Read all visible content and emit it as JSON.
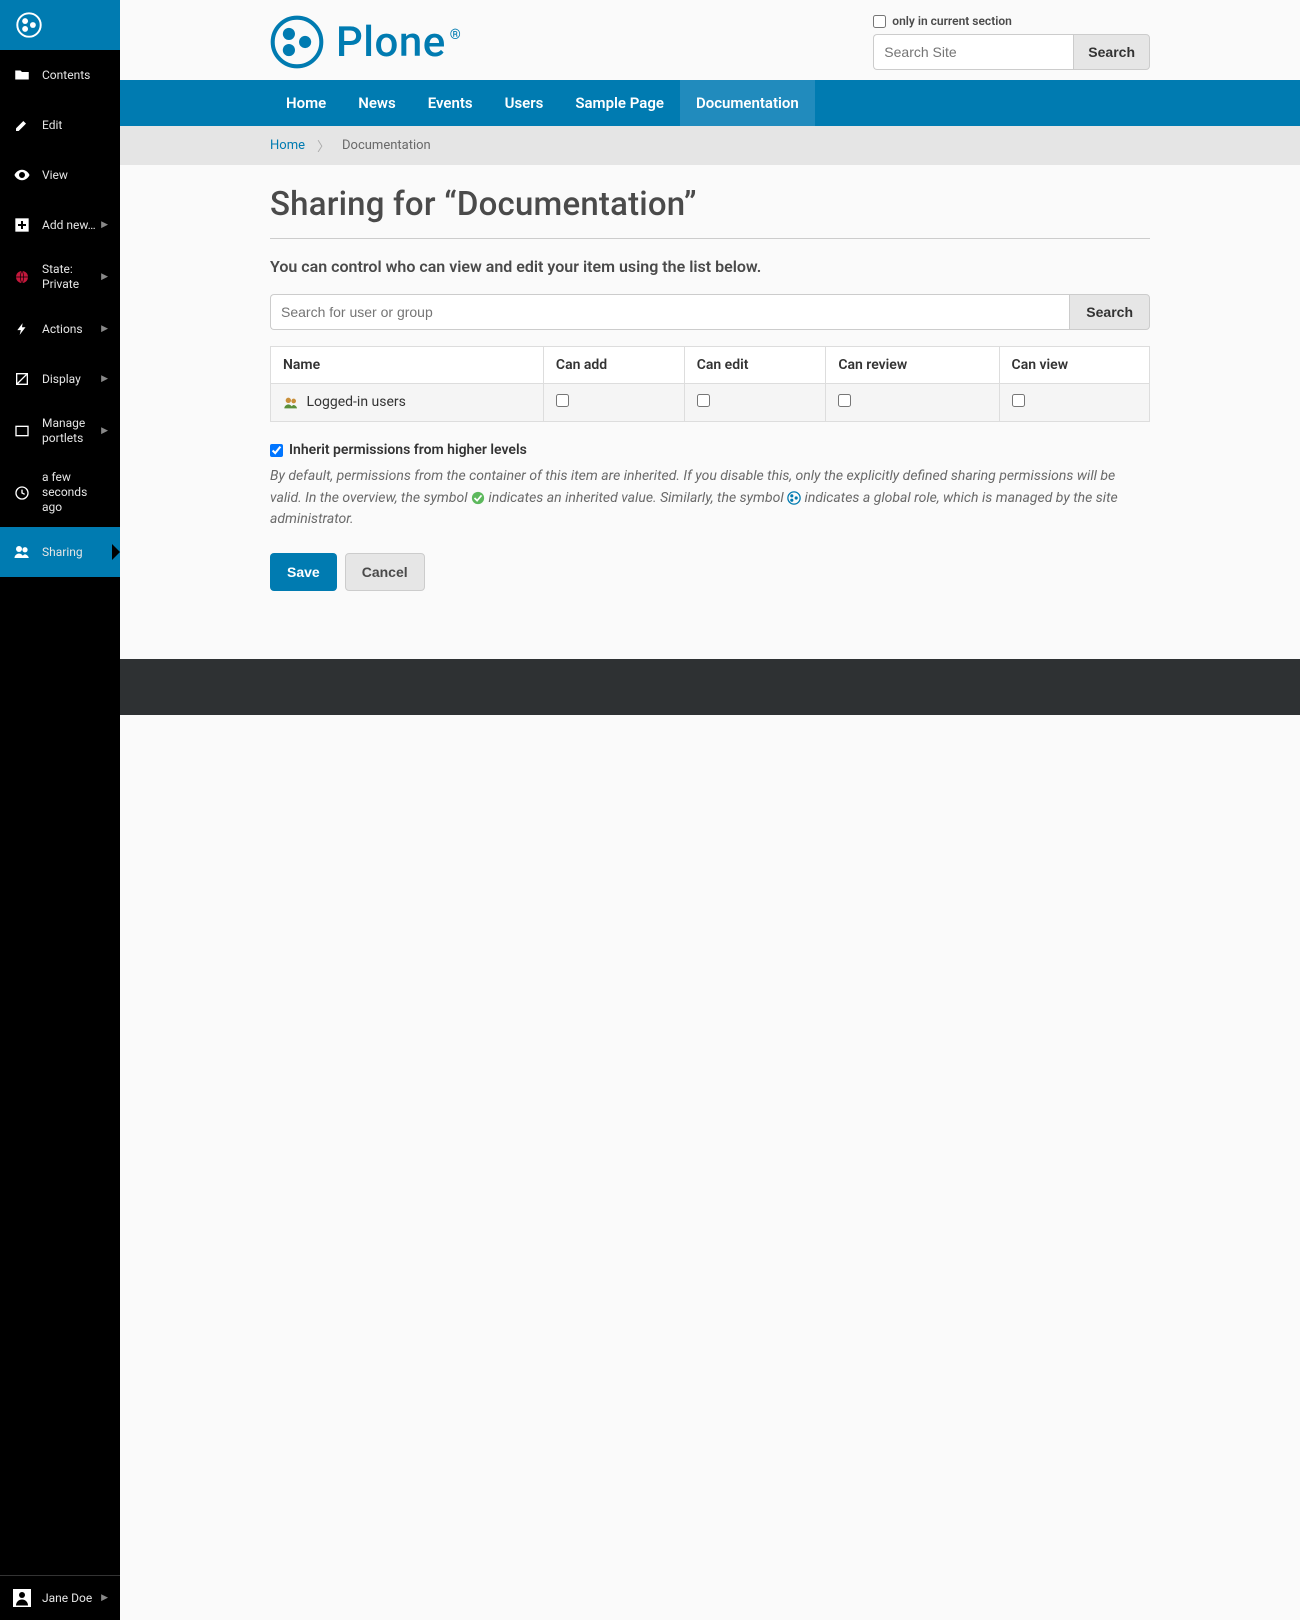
{
  "sidebar": {
    "items": [
      {
        "label": "Contents",
        "icon": "folder-icon",
        "caret": false
      },
      {
        "label": "Edit",
        "icon": "pencil-icon",
        "caret": false
      },
      {
        "label": "View",
        "icon": "eye-icon",
        "caret": false
      },
      {
        "label": "Add new…",
        "icon": "plus-icon",
        "caret": true
      },
      {
        "label": "State: Private",
        "icon": "globe-red-icon",
        "caret": true
      },
      {
        "label": "Actions",
        "icon": "bolt-icon",
        "caret": true
      },
      {
        "label": "Display",
        "icon": "shapes-icon",
        "caret": true
      },
      {
        "label": "Manage portlets",
        "icon": "square-icon",
        "caret": true
      },
      {
        "label": "a few seconds ago",
        "icon": "clock-icon",
        "caret": false
      },
      {
        "label": "Sharing",
        "icon": "people-icon",
        "caret": false,
        "active": true
      }
    ],
    "user": {
      "label": "Jane Doe",
      "icon": "user-icon"
    }
  },
  "brand": {
    "name": "Plone"
  },
  "search": {
    "only_label": "only in current section",
    "placeholder": "Search Site",
    "button": "Search"
  },
  "nav": {
    "tabs": [
      {
        "label": "Home"
      },
      {
        "label": "News"
      },
      {
        "label": "Events"
      },
      {
        "label": "Users"
      },
      {
        "label": "Sample Page"
      },
      {
        "label": "Documentation",
        "active": true
      }
    ]
  },
  "breadcrumb": {
    "home": "Home",
    "current": "Documentation"
  },
  "page": {
    "title": "Sharing for “Documentation”",
    "subtitle": "You can control who can view and edit your item using the list below.",
    "user_search_placeholder": "Search for user or group",
    "user_search_button": "Search",
    "table": {
      "headers": [
        "Name",
        "Can add",
        "Can edit",
        "Can review",
        "Can view"
      ],
      "rows": [
        {
          "name": "Logged-in users",
          "can_add": false,
          "can_edit": false,
          "can_review": false,
          "can_view": false
        }
      ]
    },
    "inherit_label": "Inherit permissions from higher levels",
    "inherit_desc_1": "By default, permissions from the container of this item are inherited. If you disable this, only the explicitly defined sharing permissions will be valid. In the overview, the symbol ",
    "inherit_desc_2": " indicates an inherited value. Similarly, the symbol ",
    "inherit_desc_3": " indicates a global role, which is managed by the site administrator.",
    "save_label": "Save",
    "cancel_label": "Cancel"
  }
}
